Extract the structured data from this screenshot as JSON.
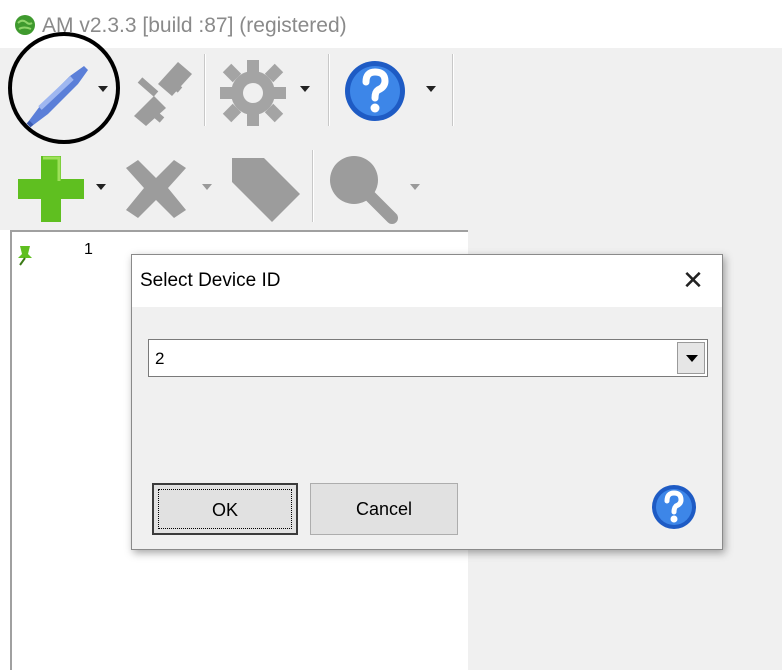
{
  "window": {
    "title": "AM v2.3.3 [build :87] (registered)",
    "app_icon": "green-globe-icon"
  },
  "toolbar_row1": [
    {
      "name": "connect-icon",
      "dropdown": true,
      "enabled": true
    },
    {
      "name": "disconnect-icon",
      "dropdown": false,
      "enabled": false
    },
    {
      "name": "settings-gear-icon",
      "dropdown": true,
      "enabled": false
    },
    {
      "name": "help-icon",
      "dropdown": true,
      "enabled": true
    }
  ],
  "toolbar_row2": [
    {
      "name": "add-plus-icon",
      "dropdown": true,
      "enabled": true
    },
    {
      "name": "delete-x-icon",
      "dropdown": true,
      "enabled": false
    },
    {
      "name": "tag-icon",
      "dropdown": false,
      "enabled": false
    },
    {
      "name": "search-magnifier-icon",
      "dropdown": true,
      "enabled": false
    }
  ],
  "tree": {
    "items": [
      {
        "icon": "green-pin-icon",
        "label": "1"
      }
    ]
  },
  "dialog": {
    "title": "Select Device ID",
    "close_glyph": "✕",
    "device_id": {
      "value": "2"
    },
    "ok_label": "OK",
    "cancel_label": "Cancel",
    "help_icon": "help-icon"
  },
  "colors": {
    "toolbar_bg": "#f0f0f0",
    "help_blue": "#2a6fd6",
    "add_green": "#5fbf20",
    "connect_blue": "#5b7fd8"
  }
}
